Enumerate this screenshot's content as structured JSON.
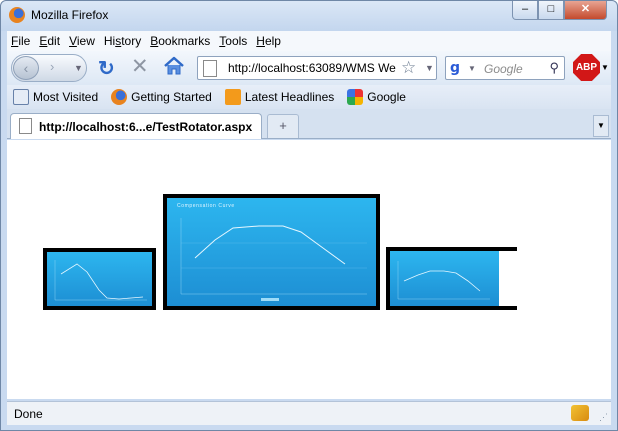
{
  "window": {
    "title": "Mozilla Firefox",
    "controls": {
      "minimize": "–",
      "maximize": "□",
      "close": "✕"
    }
  },
  "menubar": {
    "items": [
      {
        "accel": "F",
        "rest": "ile"
      },
      {
        "accel": "E",
        "rest": "dit"
      },
      {
        "accel": "V",
        "rest": "iew"
      },
      {
        "accel": "",
        "rest": "Hi",
        "accel2": "s",
        "rest2": "tory"
      },
      {
        "accel": "B",
        "rest": "ookmarks"
      },
      {
        "accel": "T",
        "rest": "ools"
      },
      {
        "accel": "H",
        "rest": "elp"
      }
    ]
  },
  "toolbar": {
    "back": "‹",
    "forward": "›",
    "reload": "↻",
    "stop": "✕",
    "url": "http://localhost:63089/WMS We",
    "search_placeholder": "Google",
    "adblock_label": "ABP"
  },
  "bookmarks": {
    "items": [
      "Most Visited",
      "Getting Started",
      "Latest Headlines",
      "Google"
    ]
  },
  "tabs": {
    "active_label": "http://localhost:6...e/TestRotator.aspx",
    "new_tab": "+"
  },
  "content": {
    "carousel_title": "Compensation Curve"
  },
  "status": {
    "text": "Done"
  },
  "colors": {
    "chart_bg_top": "#2db6ef",
    "chart_bg_bottom": "#1d8ed3",
    "frame": "#000000"
  }
}
